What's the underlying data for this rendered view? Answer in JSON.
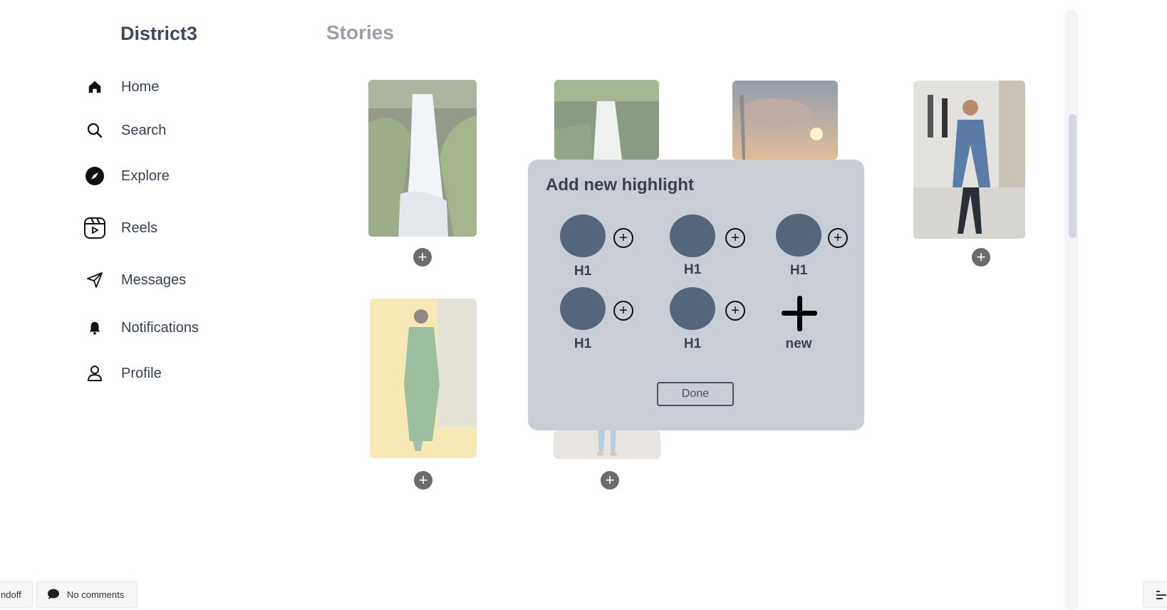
{
  "brand": "District3",
  "nav": [
    {
      "label": "Home",
      "icon": "home-icon"
    },
    {
      "label": "Search",
      "icon": "search-icon"
    },
    {
      "label": "Explore",
      "icon": "compass-icon"
    },
    {
      "label": "Reels",
      "icon": "reels-icon"
    },
    {
      "label": "Messages",
      "icon": "send-icon"
    },
    {
      "label": "Notifications",
      "icon": "bell-icon"
    },
    {
      "label": "Profile",
      "icon": "user-icon"
    }
  ],
  "main": {
    "title": "Stories",
    "stories": [
      {
        "subject": "waterfall"
      },
      {
        "subject": "forest waterfall"
      },
      {
        "subject": "sunset clouds"
      },
      {
        "subject": "man in blue coat"
      },
      {
        "subject": "runway model"
      },
      {
        "subject": "street fashion"
      }
    ],
    "add_symbol": "+"
  },
  "modal": {
    "title": "Add new highlight",
    "highlights": [
      {
        "label": "H1"
      },
      {
        "label": "H1"
      },
      {
        "label": "H1"
      },
      {
        "label": "H1"
      },
      {
        "label": "H1"
      }
    ],
    "new_label": "new",
    "done_label": "Done",
    "add_symbol": "+"
  },
  "footer": {
    "left_pill": "ndoff",
    "comments": "No comments"
  }
}
